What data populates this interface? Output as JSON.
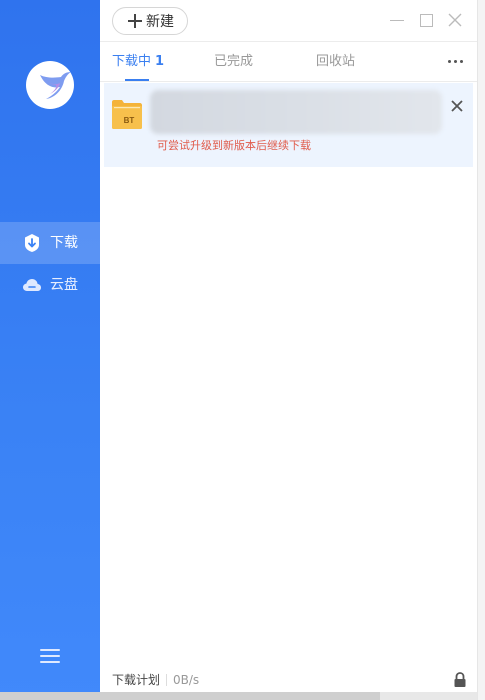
{
  "app": {
    "accent": "#3a7ff0",
    "sidebar_color": "#3a82f5"
  },
  "sidebar": {
    "items": [
      {
        "label": "下载",
        "icon": "download-shield-icon",
        "active": true
      },
      {
        "label": "云盘",
        "icon": "cloud-drive-icon",
        "active": false
      }
    ],
    "menu_icon": "hamburger-menu-icon"
  },
  "toolbar": {
    "new_label": "新建"
  },
  "tabs": [
    {
      "label": "下载中",
      "count": "1",
      "active": true
    },
    {
      "label": "已完成",
      "active": false
    },
    {
      "label": "回收站",
      "active": false
    }
  ],
  "task": {
    "icon_label": "BT",
    "message": "可尝试升级到新版本后继续下载",
    "message_color": "#e05b4b"
  },
  "footer": {
    "plan_label": "下载计划",
    "speed": "0B/s"
  }
}
